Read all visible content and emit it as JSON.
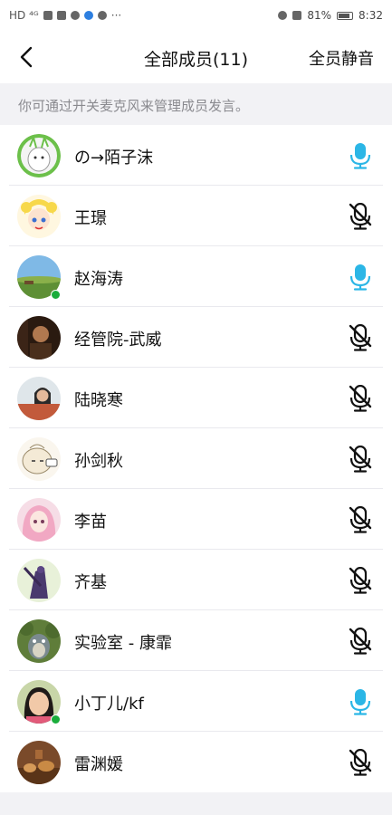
{
  "status_bar": {
    "left_text": "HD ⁴ᴳ",
    "battery": "81%",
    "time": "8:32",
    "more": "···"
  },
  "nav": {
    "title": "全部成员(11)",
    "mute_all": "全员静音"
  },
  "hint": "你可通过开关麦克风来管理成员发言。",
  "colors": {
    "mic_on": "#2bb6e6",
    "mic_off": "#111111",
    "online_badge": "#1aad3b"
  },
  "members": [
    {
      "name": "の→陌子沫",
      "mic": "on",
      "avatar": "green-cat-avatar",
      "online": false
    },
    {
      "name": "王璟",
      "mic": "off",
      "avatar": "sailor-moon-avatar",
      "online": false
    },
    {
      "name": "赵海涛",
      "mic": "on",
      "avatar": "grassland-avatar",
      "online": true
    },
    {
      "name": "经管院-武威",
      "mic": "off",
      "avatar": "dark-portrait-avatar",
      "online": false
    },
    {
      "name": "陆晓寒",
      "mic": "off",
      "avatar": "woman-photo-avatar",
      "online": false
    },
    {
      "name": "孙剑秋",
      "mic": "off",
      "avatar": "steamed-bun-avatar",
      "online": false
    },
    {
      "name": "李苗",
      "mic": "off",
      "avatar": "pink-hair-avatar",
      "online": false
    },
    {
      "name": "齐基",
      "mic": "off",
      "avatar": "purple-warrior-avatar",
      "online": false
    },
    {
      "name": "实验室 - 康霏",
      "mic": "off",
      "avatar": "totoro-avatar",
      "online": false
    },
    {
      "name": "小丁儿/kf",
      "mic": "on",
      "avatar": "girl-photo-avatar",
      "online": true
    },
    {
      "name": "雷渊媛",
      "mic": "off",
      "avatar": "bakery-avatar",
      "online": false
    }
  ]
}
